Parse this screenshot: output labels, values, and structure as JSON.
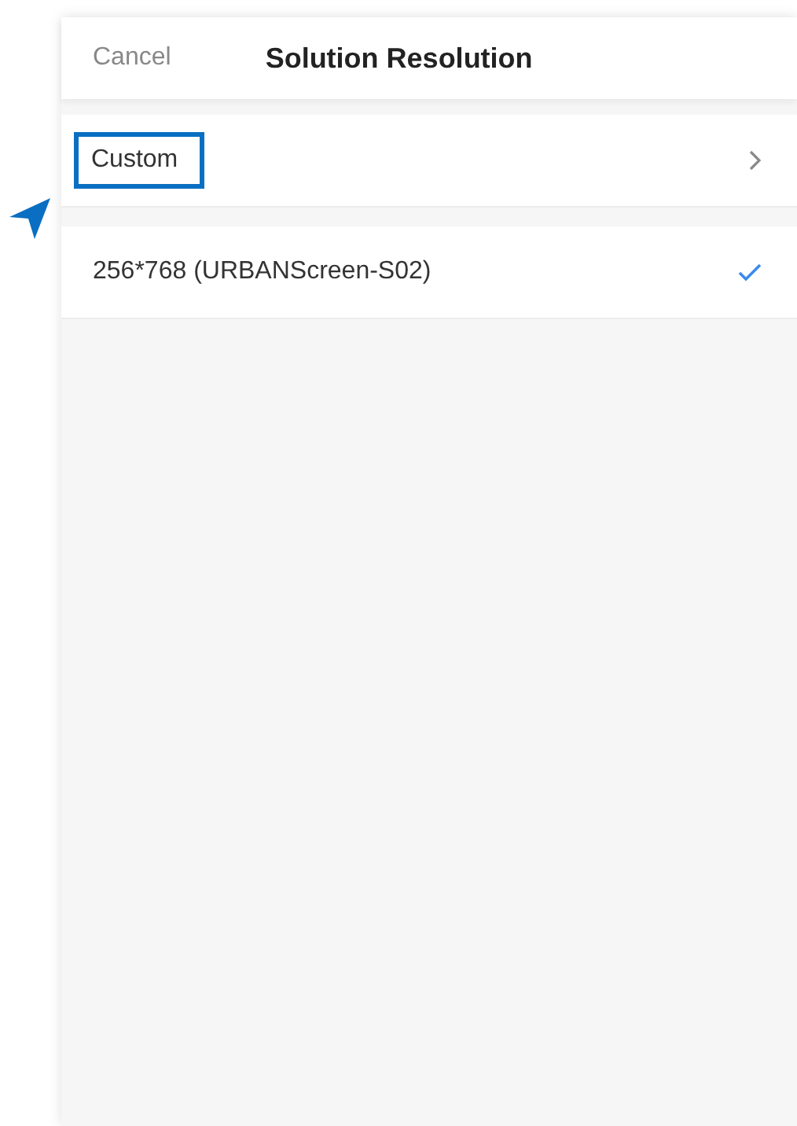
{
  "header": {
    "cancel": "Cancel",
    "title": "Solution Resolution"
  },
  "items": [
    {
      "kind": "submenu",
      "label": "Custom",
      "highlighted": true
    },
    {
      "kind": "option",
      "label": "256*768 (URBANScreen-S02)",
      "selected": true
    }
  ]
}
